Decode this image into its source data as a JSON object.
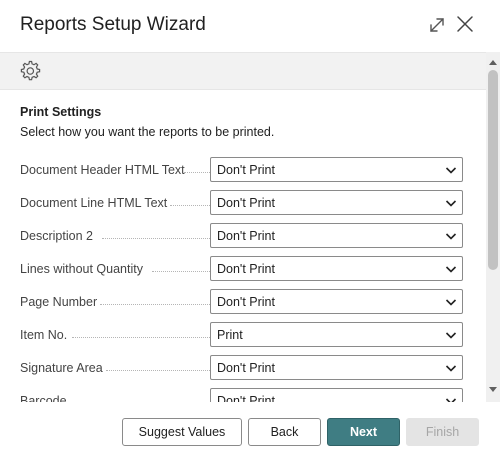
{
  "dialog": {
    "title": "Reports Setup Wizard"
  },
  "section": {
    "title": "Print Settings",
    "description": "Select how you want the reports to be printed."
  },
  "fields": [
    {
      "label": "Document Header HTML Text",
      "value": "Don't Print"
    },
    {
      "label": "Document Line HTML Text",
      "value": "Don't Print"
    },
    {
      "label": "Description 2",
      "value": "Don't Print"
    },
    {
      "label": "Lines without Quantity",
      "value": "Don't Print"
    },
    {
      "label": "Page Number",
      "value": "Don't Print"
    },
    {
      "label": "Item No.",
      "value": "Print"
    },
    {
      "label": "Signature Area",
      "value": "Don't Print"
    },
    {
      "label": "Barcode",
      "value": "Don't Print"
    }
  ],
  "footer": {
    "suggest_label": "Suggest Values",
    "back_label": "Back",
    "next_label": "Next",
    "finish_label": "Finish"
  },
  "icons": {
    "expand": "expand-icon",
    "close": "close-icon",
    "settings": "gear-icon",
    "dropdown": "chevron-down-icon"
  },
  "colors": {
    "primary_button": "#3f7d83",
    "disabled_button": "#e4e4e4",
    "toolbar_bg": "#f2f2f2"
  }
}
